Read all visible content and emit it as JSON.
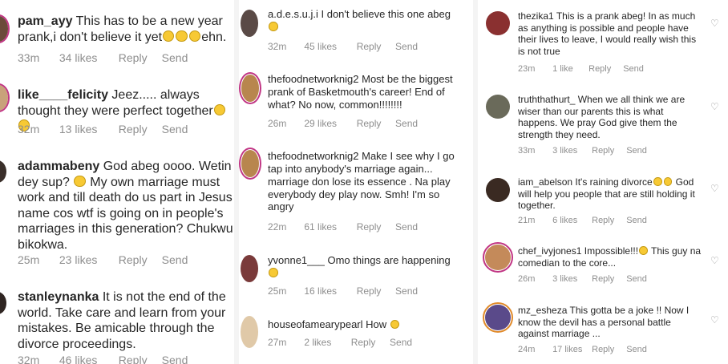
{
  "col1": [
    {
      "user": "pam_ayy",
      "text": "This has to be a new year prank,i don't believe it yet",
      "tail": "ehn.",
      "time": "33m",
      "likes": "34 likes",
      "reply": "Reply",
      "send": "Send"
    },
    {
      "user": "like____felicity",
      "text": "Jeez..... always thought they were perfect together",
      "time": "32m",
      "likes": "13 likes",
      "reply": "Reply",
      "send": "Send"
    },
    {
      "user": "adammabeny",
      "text": "God abeg oooo. Wetin dey sup?",
      "text2": "My own marriage must work and till death do us part in Jesus name cos wtf is going on in people's marriages in this generation? Chukwu bikokwa.",
      "time": "25m",
      "likes": "23 likes",
      "reply": "Reply",
      "send": "Send"
    },
    {
      "user": "stanleynanka",
      "text": "It is not the end of the world. Take care and learn from your mistakes. Be amicable through the divorce proceedings.",
      "time": "32m",
      "likes": "46 likes",
      "reply": "Reply",
      "send": "Send"
    }
  ],
  "col2": [
    {
      "user": "a.d.e.s.u.j.i",
      "text": "I don't believe this one abeg",
      "time": "32m",
      "likes": "45 likes",
      "reply": "Reply",
      "send": "Send"
    },
    {
      "user": "thefoodnetworknig2",
      "text": "Most be the biggest prank of Basketmouth's career! End of what? No now, common!!!!!!!!",
      "time": "26m",
      "likes": "29 likes",
      "reply": "Reply",
      "send": "Send"
    },
    {
      "user": "thefoodnetworknig2",
      "text": "Make I see why I go tap into anybody's marriage again... marriage don lose its essence . Na play everybody dey play now. Smh! I'm so angry",
      "time": "22m",
      "likes": "61 likes",
      "reply": "Reply",
      "send": "Send"
    },
    {
      "user": "yvonne1___",
      "text": "Omo things are happening",
      "time": "25m",
      "likes": "16 likes",
      "reply": "Reply",
      "send": "Send"
    },
    {
      "user": "houseofamearypearl",
      "text": "How",
      "time": "27m",
      "likes": "2 likes",
      "reply": "Reply",
      "send": "Send"
    }
  ],
  "col3": [
    {
      "user": "thezika1",
      "text": "This is a prank abeg! In as much as anything is possible and people have their lives to leave, I would really wish this is not true",
      "time": "23m",
      "likes": "1 like",
      "reply": "Reply",
      "send": "Send"
    },
    {
      "user": "truththathurt_",
      "text": "When we all think we are wiser than our parents this is what happens.  We pray God give them the strength they need.",
      "time": "33m",
      "likes": "3 likes",
      "reply": "Reply",
      "send": "Send"
    },
    {
      "user": "iam_abelson",
      "text": "It's raining divorce",
      "text2": "God will help you people that are still holding it together.",
      "time": "21m",
      "likes": "6 likes",
      "reply": "Reply",
      "send": "Send"
    },
    {
      "user": "chef_ivyjones1",
      "text": "Impossible!!!",
      "text2": "This guy na comedian to the core...",
      "time": "26m",
      "likes": "3 likes",
      "reply": "Reply",
      "send": "Send"
    },
    {
      "user": "mz_esheza",
      "text": "This gotta be a joke !! Now I know the devil has a personal battle against marriage ...",
      "time": "24m",
      "likes": "17 likes",
      "reply": "Reply",
      "send": "Send"
    }
  ]
}
